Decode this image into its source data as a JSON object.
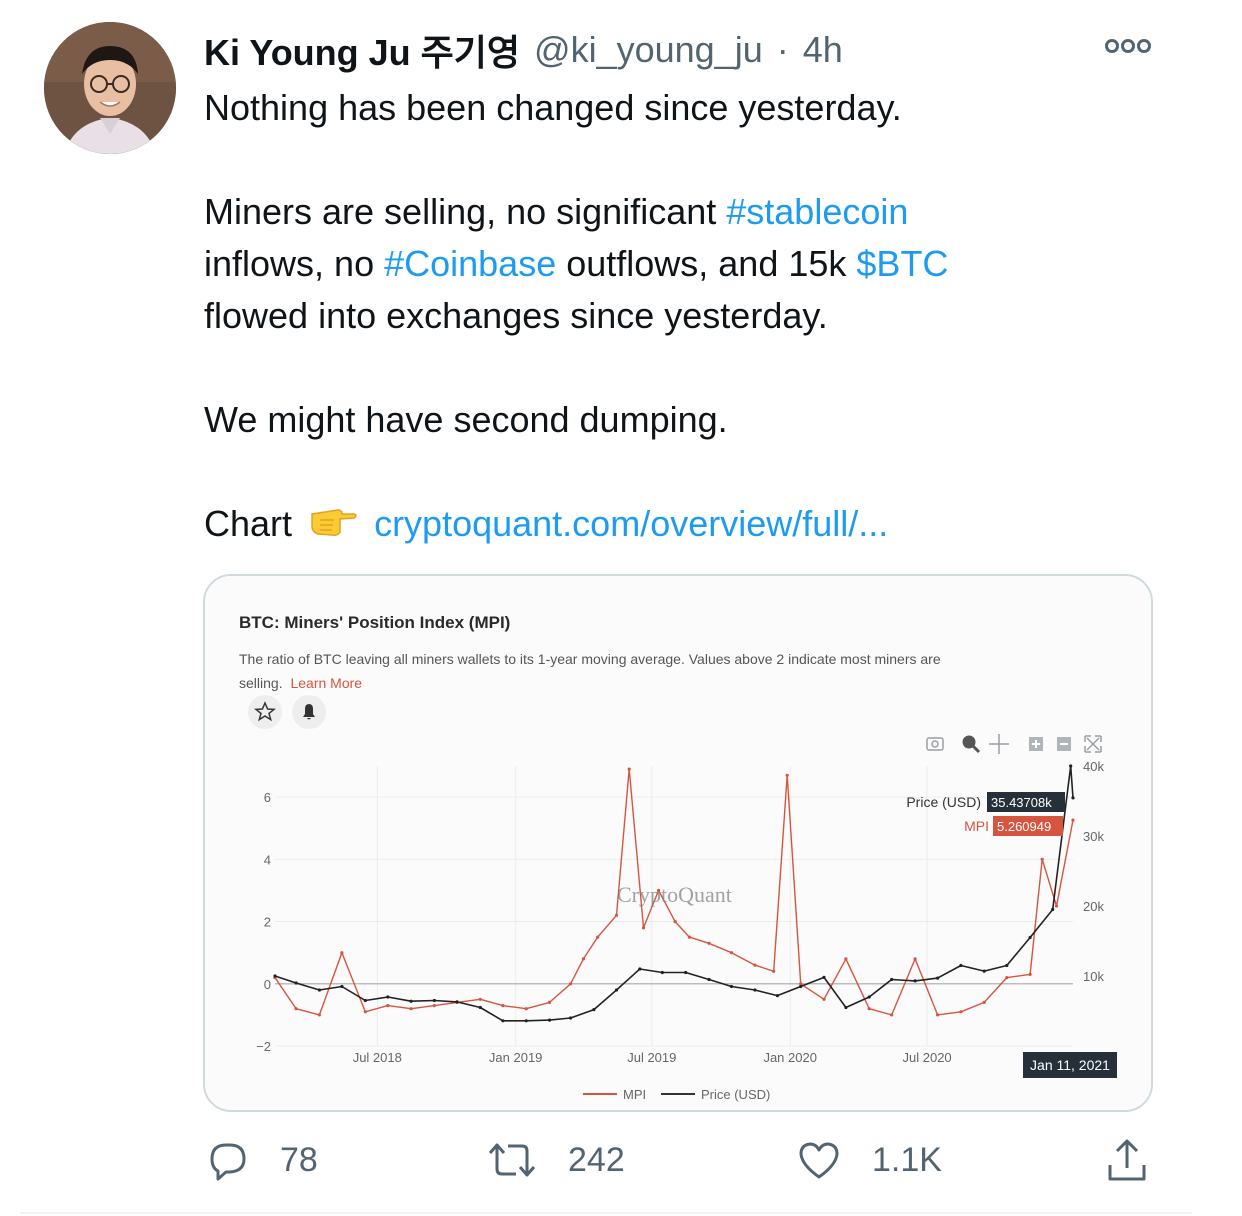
{
  "tweet": {
    "author_name": "Ki Young Ju 주기영",
    "handle": "@ki_young_ju",
    "separator": "·",
    "time": "4h",
    "line1": "Nothing has been changed since yesterday.",
    "p2_text1": "Miners are selling, no significant ",
    "p2_hashtag1": "#stablecoin",
    "p2_text2": "inflows, no ",
    "p2_hashtag2": "#Coinbase",
    "p2_text3": " outflows, and 15k ",
    "p2_cashtag": "$BTC",
    "p2_text4": "flowed into exchanges since yesterday.",
    "line3": "We might have second dumping.",
    "chart_prefix": "Chart",
    "chart_emoji_icon": "backhand-index-pointing-right-icon",
    "chart_link": "cryptoquant.com/overview/full/..."
  },
  "chart_card": {
    "title": "BTC: Miners' Position Index (MPI)",
    "description_line1": "The ratio of BTC leaving all miners wallets to its 1-year moving average. Values above 2 indicate most miners are",
    "description_line2": "selling.",
    "learn_more": "Learn More",
    "watermark": "CryptoQuant",
    "toolbar_icons": [
      "camera-icon",
      "zoom-icon",
      "pan-icon",
      "zoom-in-icon",
      "zoom-out-icon",
      "autoscale-icon"
    ],
    "price_hover_label": "Price (USD)",
    "price_hover_value": "35.43708k",
    "mpi_hover_label": "MPI",
    "mpi_hover_value": "5.260949",
    "x_hover_value": "Jan 11, 2021",
    "legend_mpi": "MPI",
    "legend_price": "Price (USD)",
    "colors": {
      "mpi": "#d6553f",
      "price": "#222222",
      "hover_dark": "#25303b"
    }
  },
  "chart_data": {
    "type": "line",
    "title": "BTC: Miners' Position Index (MPI)",
    "x_ticks": [
      "Jul 2018",
      "Jan 2019",
      "Jul 2019",
      "Jan 2020",
      "Jul 2020"
    ],
    "y_left_ticks": [
      -2,
      0,
      2,
      4,
      6
    ],
    "y_right_ticks": [
      "10k",
      "20k",
      "30k",
      "40k"
    ],
    "y_left_range": [
      -2,
      7
    ],
    "y_right_range": [
      0,
      40000
    ],
    "x_range": [
      "2018-02-15",
      "2021-01-11"
    ],
    "series": [
      {
        "name": "MPI",
        "axis": "left",
        "x": [
          "2018-02-15",
          "2018-03-15",
          "2018-04-15",
          "2018-05-15",
          "2018-06-15",
          "2018-07-15",
          "2018-08-15",
          "2018-09-15",
          "2018-10-15",
          "2018-11-15",
          "2018-12-15",
          "2019-01-15",
          "2019-02-15",
          "2019-03-15",
          "2019-04-01",
          "2019-04-20",
          "2019-05-15",
          "2019-06-01",
          "2019-06-20",
          "2019-07-10",
          "2019-08-01",
          "2019-08-20",
          "2019-09-15",
          "2019-10-15",
          "2019-11-15",
          "2019-12-10",
          "2019-12-28",
          "2020-01-15",
          "2020-02-15",
          "2020-03-15",
          "2020-04-15",
          "2020-05-15",
          "2020-06-15",
          "2020-07-15",
          "2020-08-15",
          "2020-09-15",
          "2020-10-15",
          "2020-11-15",
          "2020-12-01",
          "2020-12-20",
          "2021-01-11"
        ],
        "values": [
          0.2,
          -0.8,
          -1.0,
          1.0,
          -0.9,
          -0.7,
          -0.8,
          -0.7,
          -0.6,
          -0.5,
          -0.7,
          -0.8,
          -0.6,
          0.0,
          0.8,
          1.5,
          2.2,
          6.9,
          1.8,
          3.0,
          2.0,
          1.5,
          1.3,
          1.0,
          0.6,
          0.4,
          6.7,
          0.0,
          -0.5,
          0.8,
          -0.8,
          -1.0,
          0.8,
          -1.0,
          -0.9,
          -0.6,
          0.2,
          0.3,
          4.0,
          2.5,
          5.26
        ]
      },
      {
        "name": "Price (USD)",
        "axis": "right",
        "x": [
          "2018-02-15",
          "2018-03-15",
          "2018-04-15",
          "2018-05-15",
          "2018-06-15",
          "2018-07-15",
          "2018-08-15",
          "2018-09-15",
          "2018-10-15",
          "2018-11-15",
          "2018-12-15",
          "2019-01-15",
          "2019-02-15",
          "2019-03-15",
          "2019-04-15",
          "2019-05-15",
          "2019-06-15",
          "2019-07-15",
          "2019-08-15",
          "2019-09-15",
          "2019-10-15",
          "2019-11-15",
          "2019-12-15",
          "2020-01-15",
          "2020-02-15",
          "2020-03-15",
          "2020-04-15",
          "2020-05-15",
          "2020-06-15",
          "2020-07-15",
          "2020-08-15",
          "2020-09-15",
          "2020-10-15",
          "2020-11-15",
          "2020-12-15",
          "2021-01-08",
          "2021-01-11"
        ],
        "values": [
          10000,
          9000,
          8000,
          8500,
          6500,
          7000,
          6400,
          6500,
          6300,
          5500,
          3600,
          3600,
          3700,
          4000,
          5200,
          8000,
          11000,
          10500,
          10500,
          9500,
          8500,
          8000,
          7200,
          8500,
          9800,
          5500,
          7000,
          9500,
          9300,
          9700,
          11500,
          10700,
          11500,
          15500,
          19500,
          40000,
          35437
        ]
      }
    ]
  },
  "actions": {
    "reply_count": "78",
    "retweet_count": "242",
    "like_count": "1.1K"
  }
}
